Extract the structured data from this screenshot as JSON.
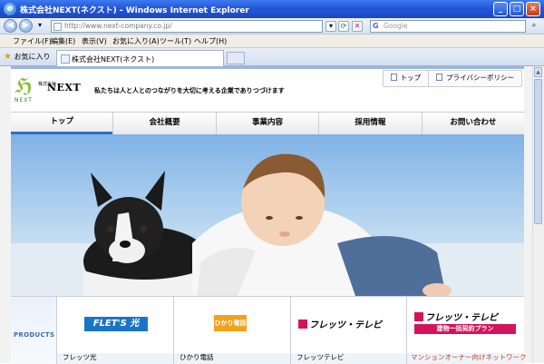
{
  "window": {
    "title": "株式会社NEXT(ネクスト) - Windows Internet Explorer",
    "icon": "ie-icon",
    "controls": [
      "minimize-icon",
      "maximize-icon",
      "close-icon"
    ]
  },
  "address_bar": {
    "url": "http://www.next-company.co.jp/",
    "search_placeholder": "Google"
  },
  "menu": {
    "items": [
      "ファイル(F)",
      "編集(E)",
      "表示(V)",
      "お気に入り(A)",
      "ツール(T)",
      "ヘルプ(H)"
    ]
  },
  "favorites": {
    "label": "お気に入り",
    "tab_title": "株式会社NEXT(ネクスト)"
  },
  "site": {
    "util_nav": [
      "トップ",
      "プライバシーポリシー"
    ],
    "logo": {
      "company_prefix": "株式会社",
      "name": "NEXT",
      "sub": "NEXT"
    },
    "tagline": "私たちは人と人とのつながりを大切に考える企業でありつづけます",
    "global_nav": [
      "トップ",
      "会社概要",
      "事業内容",
      "採用情報",
      "お問い合わせ"
    ],
    "products": {
      "label": "PRODUCTS",
      "items": [
        {
          "logo_text": "FLET'S 光",
          "caption": "フレッツ光"
        },
        {
          "logo_text": "ひかり電話",
          "caption": "ひかり電話"
        },
        {
          "logo_text": "フレッツ・テレビ",
          "caption": "フレッツテレビ"
        },
        {
          "logo_text": "フレッツ・テレビ",
          "plan_text": "建物一括契約プラン",
          "caption": "マンションオーナー向けネットワーク"
        }
      ]
    }
  },
  "colors": {
    "titlebar": "#2357d9",
    "nav_active": "#2f6fbf",
    "brand_green": "#8bbf3a",
    "flets_blue": "#1a74c8",
    "tv_red": "#d4145a"
  }
}
